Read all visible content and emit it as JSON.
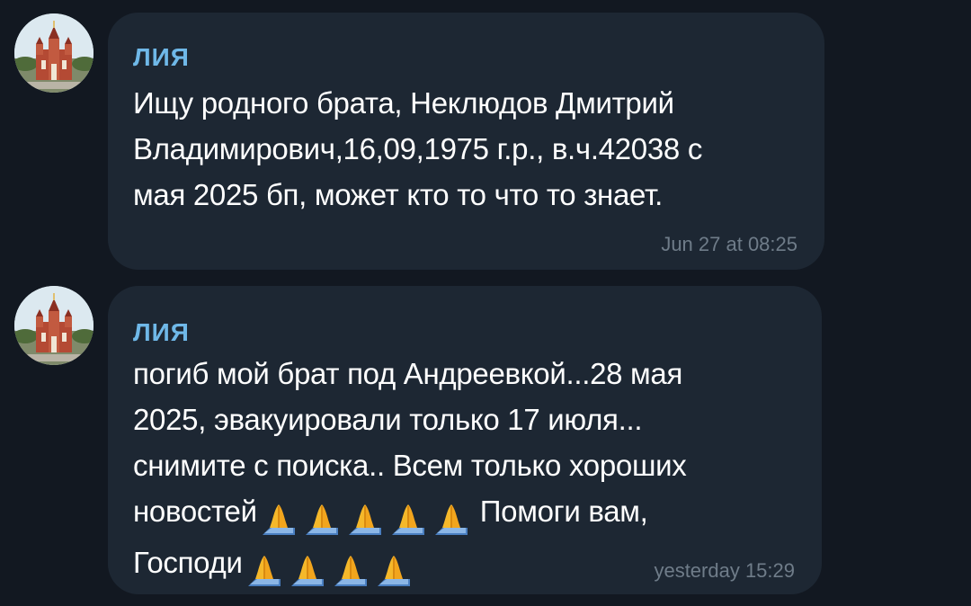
{
  "messages": [
    {
      "sender": "ЛИЯ",
      "lines": [
        "Ищу родного брата, Неклюдов Дмитрий",
        "Владимирович,16,09,1975 г.р., в.ч.42038 с",
        "мая 2025 бп, может кто то что то знает."
      ],
      "time": "Jun 27 at 08:25"
    },
    {
      "sender": "ЛИЯ",
      "lines": [
        "погиб мой брат под Андреевкой...28 мая",
        "2025, эвакуировали только 17 июля...",
        "снимите с поиска.. Всем только хороших"
      ],
      "line4_start": "новостей",
      "line4_end": "Помоги вам,",
      "line5_start": "Господи",
      "time": "yesterday 15:29"
    }
  ],
  "emoji_name": "folded-hands-emoji",
  "colors": {
    "background": "#121821",
    "bubble": "#1d2733",
    "sender": "#6fb8e8",
    "text": "#ffffff",
    "timestamp": "#6f7c89"
  }
}
